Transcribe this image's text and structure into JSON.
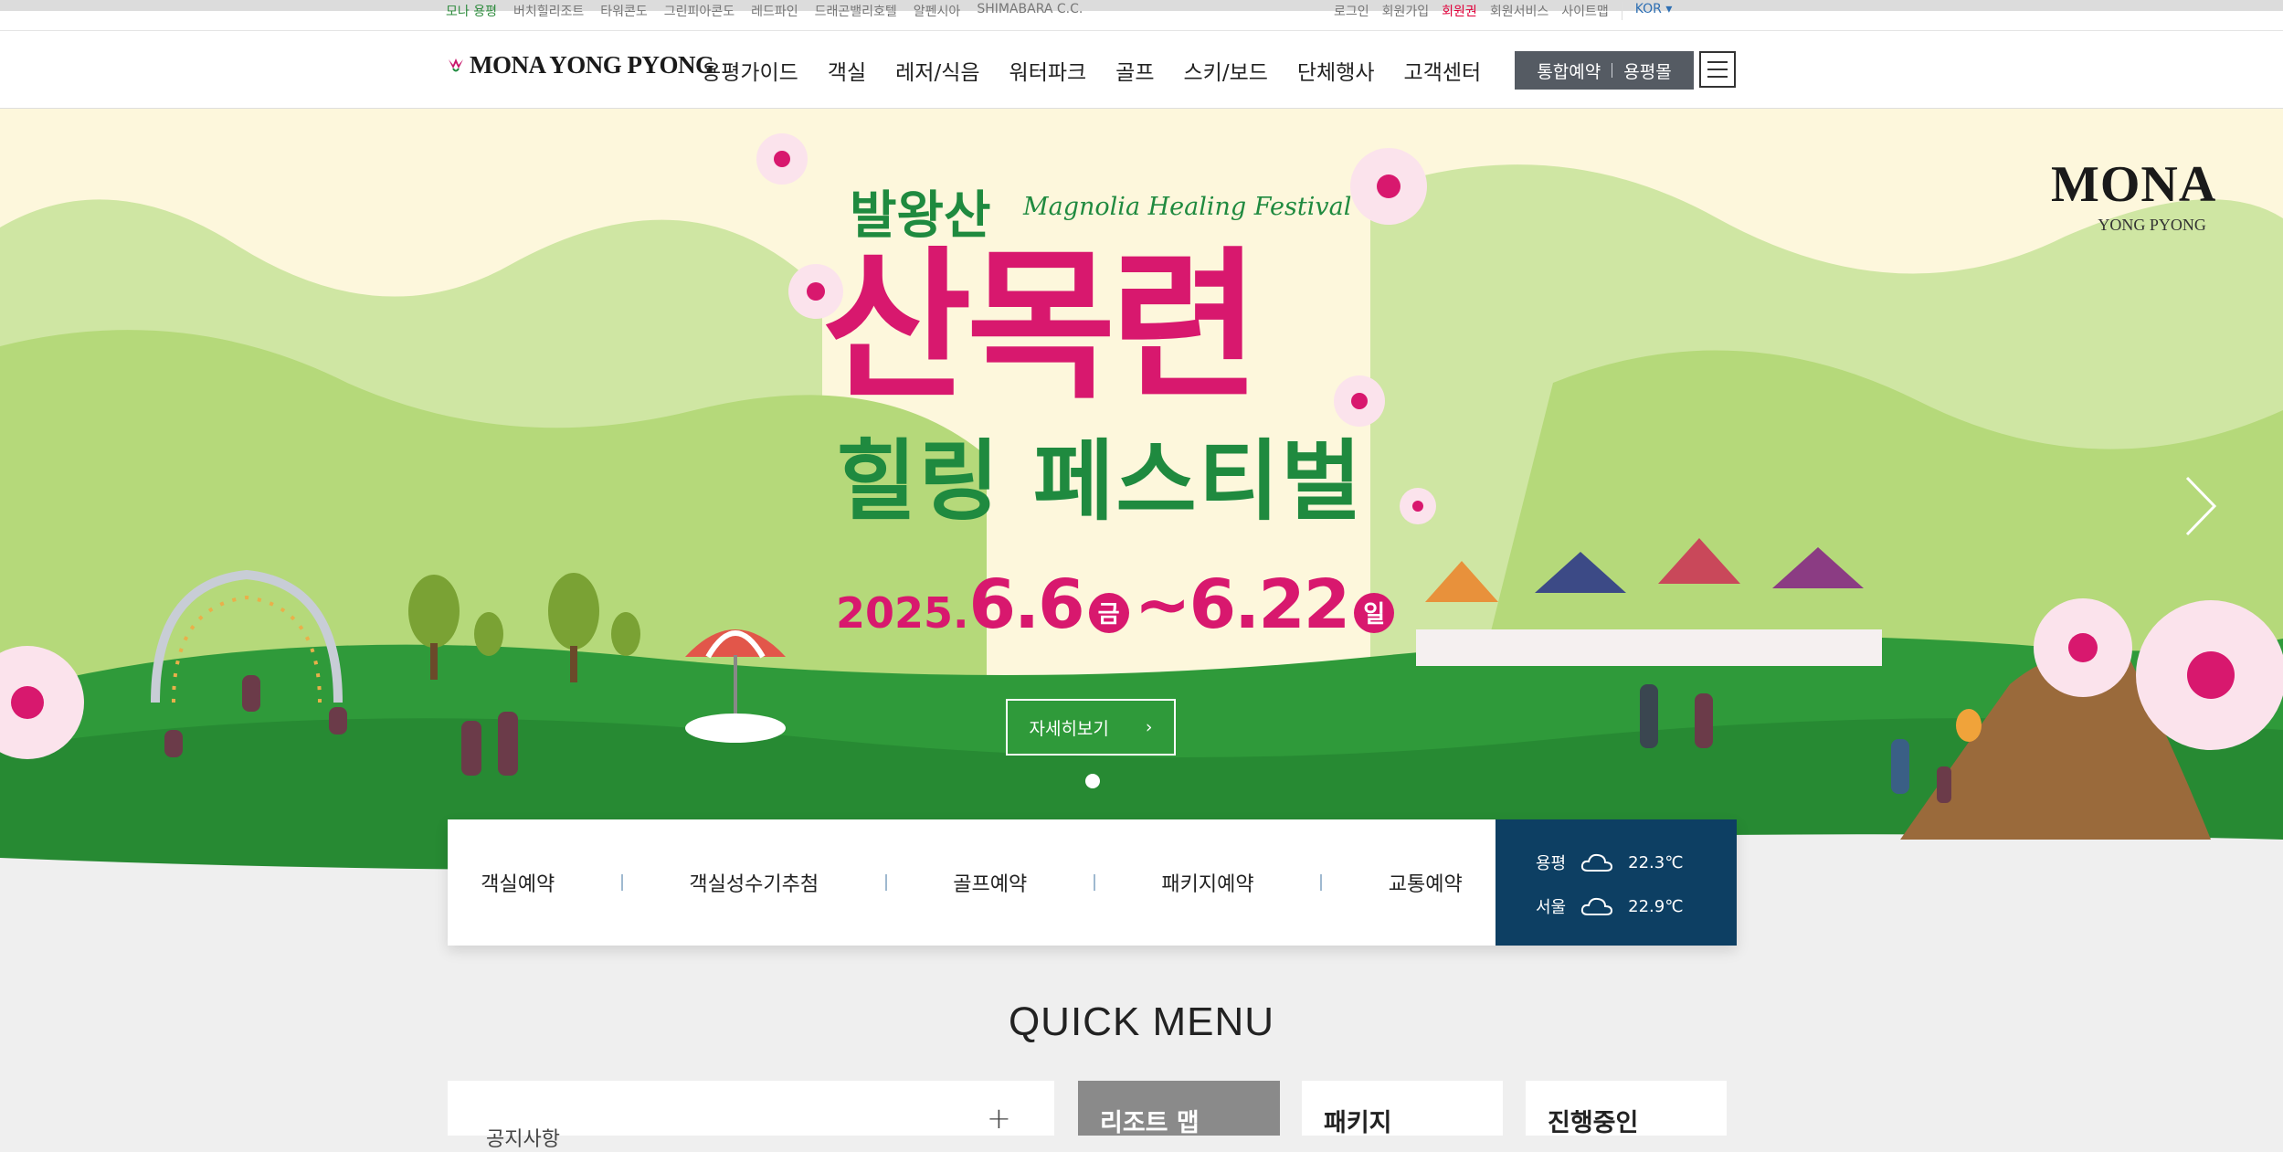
{
  "utility_bar": {
    "left_links": [
      "모나 용평",
      "버치힐리조트",
      "타워콘도",
      "그린피아콘도",
      "레드파인",
      "드래곤밸리호텔",
      "알펜시아",
      "SHIMABARA C.C."
    ],
    "right_links": [
      "로그인",
      "회원가입",
      "회원권",
      "회원서비스",
      "사이트맵"
    ],
    "accent_index": 2,
    "language": "KOR ▾"
  },
  "header": {
    "logo_text": "MONA YONG PYONG",
    "nav": [
      "용평가이드",
      "객실",
      "레저/식음",
      "워터파크",
      "골프",
      "스키/보드",
      "단체행사",
      "고객센터"
    ],
    "reserve_label": "통합예약",
    "mall_label": "용평몰",
    "menu_icon": "hamburger-icon"
  },
  "hero": {
    "line1_ko": "발왕산",
    "line1_en": "Magnolia Healing Festival",
    "title": "산목련",
    "subtitle": "힐링 페스티벌",
    "date_year": "2025.",
    "date_start": "6.6",
    "day_start": "금",
    "date_tilde": "~",
    "date_end": "6.22",
    "day_end": "일",
    "detail_label": "자세히보기",
    "detail_arrow": "›",
    "badge_brand": "MONA",
    "badge_sub": "YONG PYONG",
    "colors": {
      "green": "#1f8a3f",
      "magenta": "#d8186e",
      "cream": "#fdf7dc",
      "grass": "#2f9a3a"
    }
  },
  "booking": {
    "items": [
      "객실예약",
      "객실성수기추첨",
      "골프예약",
      "패키지예약",
      "교통예약"
    ],
    "weather": [
      {
        "city": "용평",
        "icon": "cloud-icon",
        "temp": "22.3℃"
      },
      {
        "city": "서울",
        "icon": "cloud-icon",
        "temp": "22.9℃"
      }
    ]
  },
  "quick_menu": {
    "title": "QUICK MENU",
    "cards": [
      {
        "label": "공지사항"
      },
      {
        "label": "리조트 맵"
      },
      {
        "label": "패키지"
      },
      {
        "label": "진행중인"
      }
    ]
  }
}
